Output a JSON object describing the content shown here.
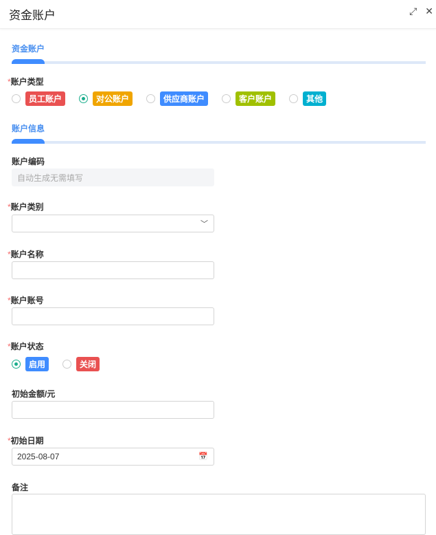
{
  "title": "资金账户",
  "section1": "资金账户",
  "account_type": {
    "label": "账户类型",
    "options": [
      {
        "label": "员工账户",
        "color": "#e95151",
        "selected": false
      },
      {
        "label": "对公账户",
        "color": "#f0a500",
        "selected": true
      },
      {
        "label": "供应商账户",
        "color": "#3f8cff",
        "selected": false
      },
      {
        "label": "客户账户",
        "color": "#a0c000",
        "selected": false
      },
      {
        "label": "其他",
        "color": "#00b0d0",
        "selected": false
      }
    ]
  },
  "section2": "账户信息",
  "code": {
    "label": "账户编码",
    "placeholder": "自动生成无需填写"
  },
  "category": {
    "label": "账户类别",
    "value": ""
  },
  "name": {
    "label": "账户名称",
    "value": ""
  },
  "number": {
    "label": "账户账号",
    "value": ""
  },
  "status": {
    "label": "账户状态",
    "options": [
      {
        "label": "启用",
        "color": "#3f8cff",
        "selected": true
      },
      {
        "label": "关闭",
        "color": "#e95151",
        "selected": false
      }
    ]
  },
  "amount": {
    "label": "初始金额/元",
    "value": ""
  },
  "date": {
    "label": "初始日期",
    "value": "2025-08-07"
  },
  "remark": {
    "label": "备注",
    "value": ""
  }
}
